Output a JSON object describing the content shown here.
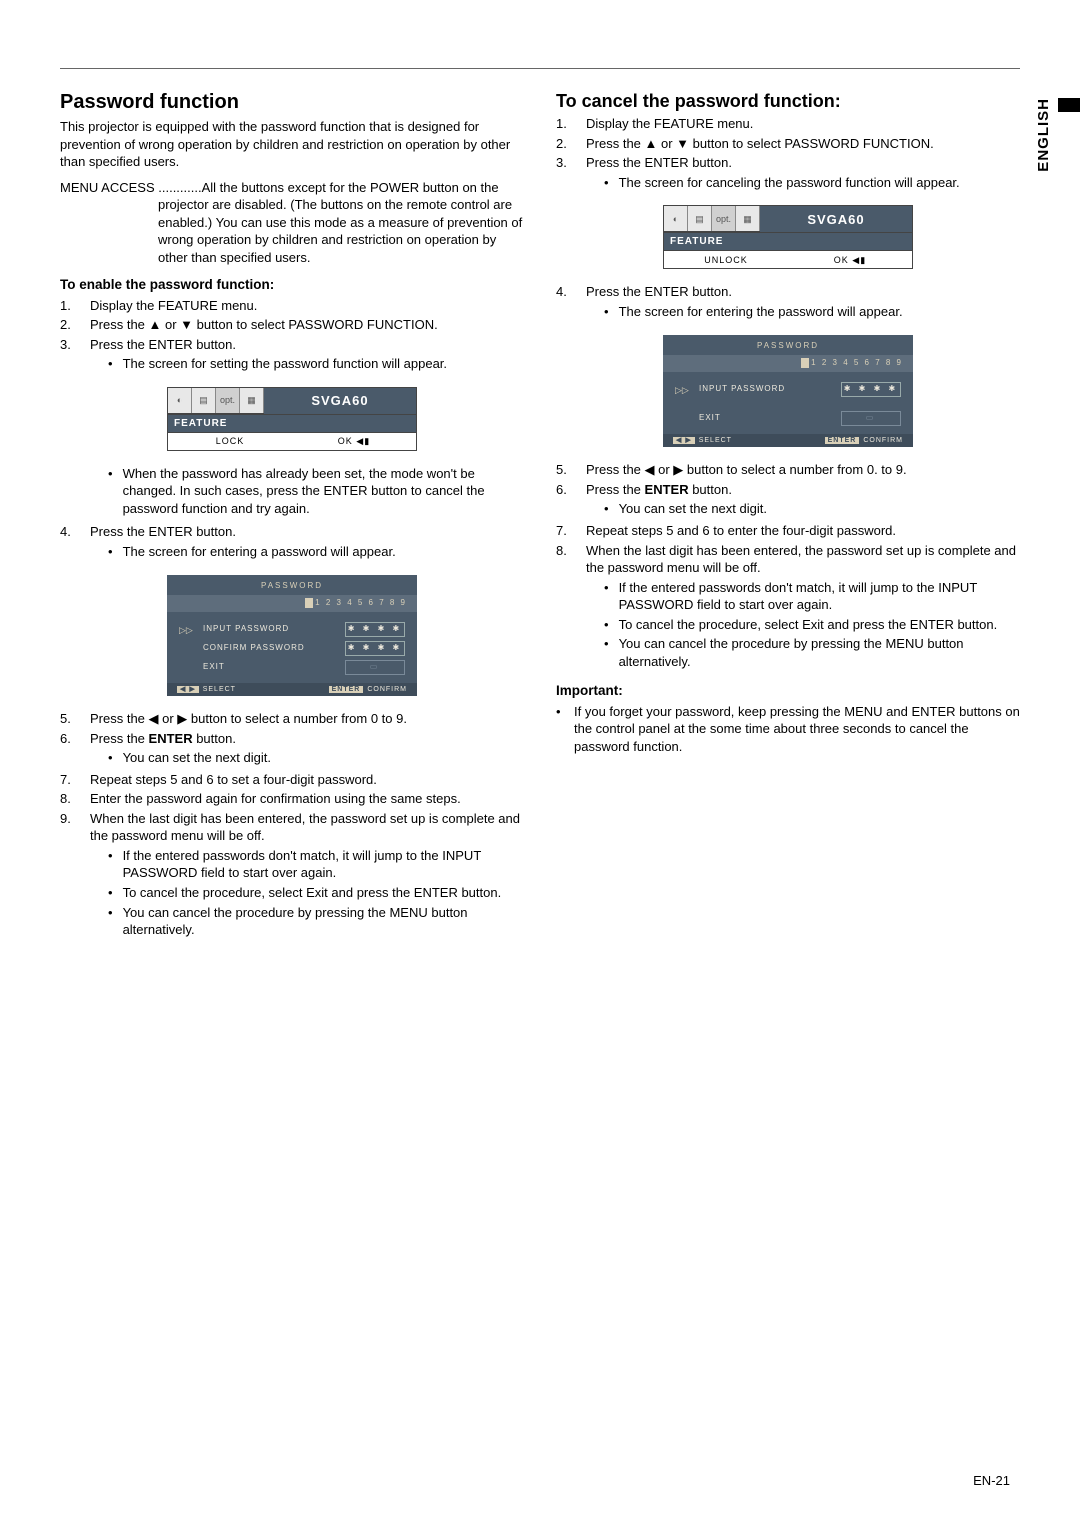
{
  "sideTab": "ENGLISH",
  "left": {
    "h1": "Password function",
    "intro": "This projector is equipped with the password function that is designed for prevention of wrong operation by children and restriction on operation by other than specified users.",
    "menuAccessLabel": "MENU ACCESS ............",
    "menuAccessText": "All the buttons except for the POWER button on the projector are disabled. (The buttons on the remote control are enabled.) You can use this mode as a measure of prevention of wrong operation by children and restriction on operation by other than specified users.",
    "h3enable": "To enable the password function:",
    "step1": "Display the FEATURE menu.",
    "step2": "Press the ▲ or ▼ button to select PASSWORD FUNCTION.",
    "step3": "Press the ENTER button.",
    "step3a": "The screen for setting the password function will appear.",
    "step3b": "When the password has already been set, the mode won't be changed. In such cases, press the ENTER button to cancel the password function and try again.",
    "step4": "Press the ENTER button.",
    "step4a": "The screen for entering a password will appear.",
    "step5": "Press the ◀ or ▶ button to select a number from 0 to 9.",
    "step6a": "Press the ",
    "step6b": "ENTER",
    "step6c": " button.",
    "step6sub": "You can set the next digit.",
    "step7": "Repeat steps 5 and 6 to set a four-digit password.",
    "step8": "Enter the password again for confirmation using the same steps.",
    "step9": "When the last digit has been entered, the password set up is complete and the password menu will be off.",
    "step9a": "If the entered passwords don't match, it will jump to the INPUT PASSWORD field to start over again.",
    "step9b": "To cancel the procedure, select Exit and press the ENTER button.",
    "step9c": "You can cancel the procedure by pressing the MENU button alternatively."
  },
  "right": {
    "h2": "To cancel the password function:",
    "step1": "Display the FEATURE menu.",
    "step2": "Press the ▲ or ▼ button to select PASSWORD FUNCTION.",
    "step3": "Press the ENTER button.",
    "step3a": "The screen for canceling the password function will appear.",
    "step4": "Press the ENTER button.",
    "step4a": "The screen for entering the password will appear.",
    "step5": "Press the ◀ or ▶ button to select a number from 0. to 9.",
    "step6a": "Press the ",
    "step6b": "ENTER",
    "step6c": " button.",
    "step6sub": "You can set the next digit.",
    "step7": "Repeat steps 5 and 6 to enter the four-digit password.",
    "step8": "When the last digit has been entered, the password set up is complete and the password menu will be off.",
    "step8a": "If the entered passwords don't match, it will jump to the INPUT PASSWORD field to start over again.",
    "step8b": "To cancel the procedure, select Exit and press the ENTER button.",
    "step8c": "You can cancel the procedure by pressing the MENU button alternatively.",
    "importantH": "Important:",
    "importantText": "If you forget your password, keep pressing the MENU and ENTER buttons on the control panel at the some time about three seconds to cancel the password function."
  },
  "osd1": {
    "title": "SVGA60",
    "feature": "FEATURE",
    "lock": "LOCK",
    "ok": "OK ◀▮",
    "opt": "opt."
  },
  "osd2": {
    "title": "SVGA60",
    "feature": "FEATURE",
    "unlock": "UNLOCK",
    "ok": "OK ◀▮",
    "opt": "opt."
  },
  "pwd1": {
    "title": "PASSWORD",
    "digits": "1 2 3 4 5 6 7 8 9",
    "input": "INPUT  PASSWORD",
    "confirm": "CONFIRM  PASSWORD",
    "exit": "EXIT",
    "mask": "✱ ✱ ✱ ✱",
    "selectTag": "◀ ▶",
    "select": "SELECT",
    "confirmTag": "ENTER",
    "confirmLbl": "CONFIRM"
  },
  "pwd2": {
    "title": "PASSWORD",
    "digits": "1 2 3 4 5 6 7 8 9",
    "input": "INPUT  PASSWORD",
    "exit": "EXIT",
    "mask": "✱ ✱ ✱ ✱",
    "selectTag": "◀ ▶",
    "select": "SELECT",
    "confirmTag": "ENTER",
    "confirmLbl": "CONFIRM"
  },
  "pageNum": "EN-21"
}
